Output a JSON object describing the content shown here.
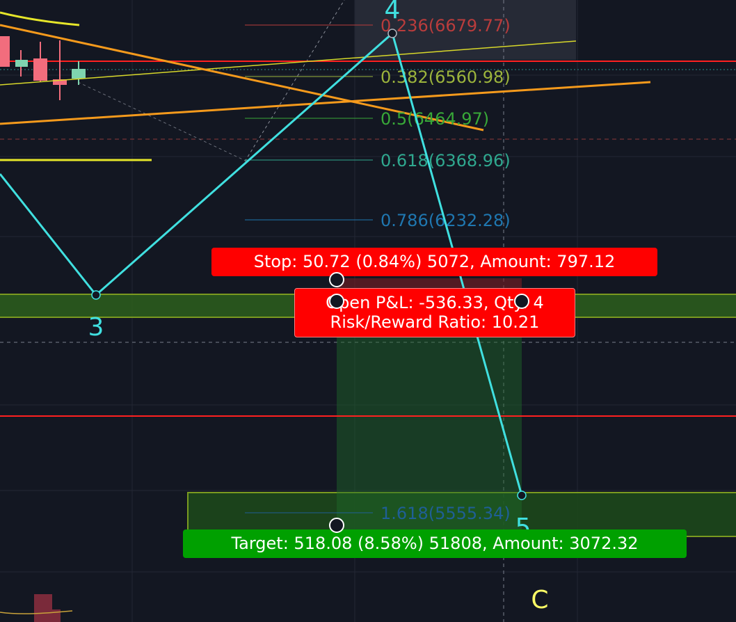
{
  "colors": {
    "background": "#131722",
    "grid": "#2a2e39",
    "wave": "#40e0e0",
    "stop": "#ff0000",
    "target": "#00a000",
    "price_line": "#ff2020",
    "trend_orange": "#f59a1c",
    "trend_yellow": "#e6e62a",
    "wave_c": "#ffff66"
  },
  "fib_levels": [
    {
      "label": "0.236(6679.77)",
      "color": "#b93c3c"
    },
    {
      "label": "0.382(6560.98)",
      "color": "#9cb43c"
    },
    {
      "label": "0.5(6464.97)",
      "color": "#38a838"
    },
    {
      "label": "0.618(6368.96)",
      "color": "#2fa88f"
    },
    {
      "label": "0.786(6232.28)",
      "color": "#1f77b0"
    },
    {
      "label": "1.618(5555.34)",
      "color": "#1f5f96"
    }
  ],
  "wave_labels": {
    "wave_4": "4",
    "wave_3": "3",
    "wave_5": "5",
    "wave_c": "C"
  },
  "position": {
    "stop_text": "Stop: 50.72 (0.84%) 5072, Amount: 797.12",
    "pnl_text": "Open P&L: -536.33, Qty: 4",
    "risk_reward_text": "Risk/Reward Ratio: 10.21",
    "target_text": "Target: 518.08 (8.58%) 51808, Amount: 3072.32"
  }
}
